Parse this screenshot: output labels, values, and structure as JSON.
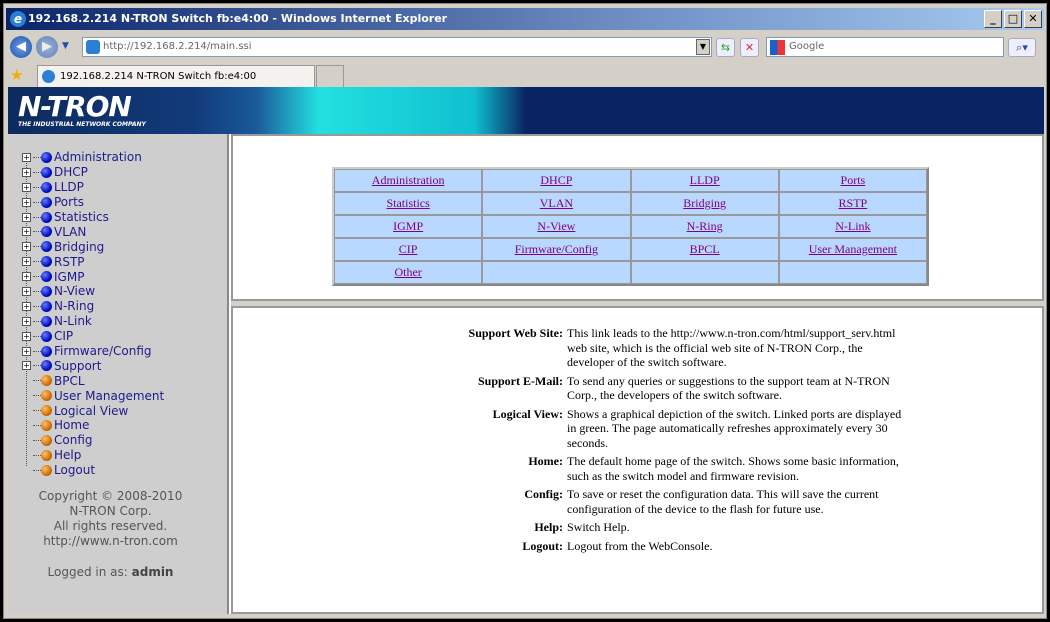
{
  "window": {
    "title": "192.168.2.214 N-TRON Switch fb:e4:00 - Windows Internet Explorer",
    "minimize": "_",
    "maximize": "□",
    "close": "✕"
  },
  "browser": {
    "address": "http://192.168.2.214/main.ssi",
    "search_placeholder": "Google",
    "tab_title": "192.168.2.214 N-TRON Switch fb:e4:00"
  },
  "banner": {
    "logo": "N-TRON",
    "tagline": "THE INDUSTRIAL NETWORK COMPANY"
  },
  "sidebar": {
    "folders": [
      "Administration",
      "DHCP",
      "LLDP",
      "Ports",
      "Statistics",
      "VLAN",
      "Bridging",
      "RSTP",
      "IGMP",
      "N-View",
      "N-Ring",
      "N-Link",
      "CIP",
      "Firmware/Config",
      "Support"
    ],
    "pages": [
      "BPCL",
      "User Management",
      "Logical View",
      "Home",
      "Config",
      "Help",
      "Logout"
    ],
    "copyright": [
      "Copyright © 2008-2010",
      "N-TRON Corp.",
      "All rights reserved.",
      "http://www.n-tron.com"
    ],
    "logged_in_label": "Logged in as:",
    "user": "admin"
  },
  "menu": [
    [
      "Administration",
      "DHCP",
      "LLDP",
      "Ports"
    ],
    [
      "Statistics",
      "VLAN",
      "Bridging",
      "RSTP"
    ],
    [
      "IGMP",
      "N-View",
      "N-Ring",
      "N-Link"
    ],
    [
      "CIP",
      "Firmware/Config",
      "BPCL",
      "User Management"
    ],
    [
      "Other",
      "",
      "",
      ""
    ]
  ],
  "descriptions": [
    {
      "label": "Support Web Site:",
      "text": "This link leads to the http://www.n-tron.com/html/support_serv.html web site, which is the official web site of N-TRON Corp., the developer of the switch software."
    },
    {
      "label": "Support E-Mail:",
      "text": "To send any queries or suggestions to the support team at N-TRON Corp., the developers of the switch software."
    },
    {
      "label": "Logical View:",
      "text": "Shows a graphical depiction of the switch. Linked ports are displayed in green. The page automatically refreshes approximately every 30 seconds."
    },
    {
      "label": "Home:",
      "text": "The default home page of the switch. Shows some basic information, such as the switch model and firmware revision."
    },
    {
      "label": "Config:",
      "text": "To save or reset the configuration data. This will save the current configuration of the device to the flash for future use."
    },
    {
      "label": "Help:",
      "text": "Switch Help."
    },
    {
      "label": "Logout:",
      "text": "Logout from the WebConsole."
    }
  ]
}
